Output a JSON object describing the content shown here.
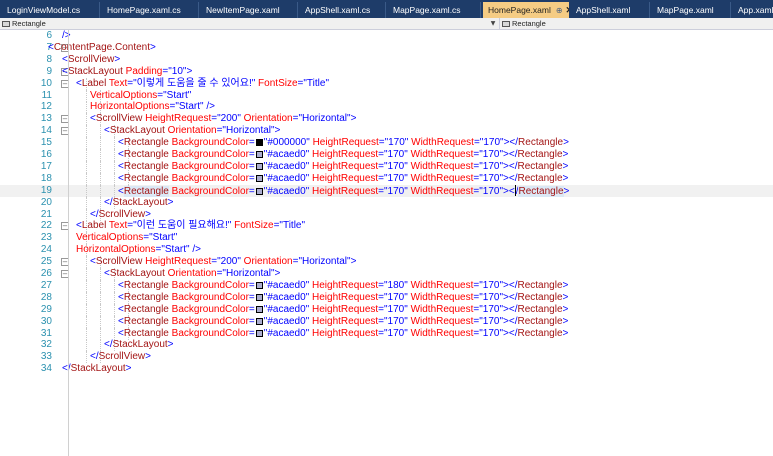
{
  "colors": {
    "tag": "#a31515",
    "attr": "#ff0000",
    "value": "#0000ff",
    "punct": "#0000ff",
    "linenum": "#2b91af",
    "swatch_black": "#000000",
    "swatch_gray": "#acaed0"
  },
  "tabs": [
    {
      "label": "LoginViewModel.cs",
      "active": false
    },
    {
      "label": "HomePage.xaml.cs",
      "active": false
    },
    {
      "label": "NewItemPage.xaml",
      "active": false
    },
    {
      "label": "AppShell.xaml.cs",
      "active": false
    },
    {
      "label": "MapPage.xaml.cs",
      "active": false
    },
    {
      "label": "HomePage.xaml",
      "active": true,
      "pin": "⊕",
      "close": "✕"
    },
    {
      "label": "AppShell.xaml",
      "active": false
    },
    {
      "label": "MapPage.xaml",
      "active": false
    },
    {
      "label": "App.xaml",
      "active": false
    }
  ],
  "navbar": {
    "left_combo": "Rectangle",
    "right_combo": "Rectangle",
    "dropdown_arrow": "▼"
  },
  "editor": {
    "lines": [
      {
        "n": "6",
        "indent": 4,
        "fold": "",
        "hl": false,
        "tokens": [
          {
            "t": "/>",
            "c": "value"
          }
        ]
      },
      {
        "n": "7",
        "indent": 3,
        "fold": "⊟",
        "hl": false,
        "tokens": [
          {
            "t": "<",
            "c": "value"
          },
          {
            "t": "ContentPage.Content",
            "c": "tag"
          },
          {
            "t": ">",
            "c": "value"
          }
        ]
      },
      {
        "n": "8",
        "indent": 4,
        "fold": "",
        "hl": false,
        "tokens": [
          {
            "t": "<",
            "c": "value"
          },
          {
            "t": "ScrollView",
            "c": "tag"
          },
          {
            "t": ">",
            "c": "value"
          }
        ]
      },
      {
        "n": "9",
        "indent": 4,
        "fold": "⊟",
        "hl": false,
        "tokens": [
          {
            "t": "<",
            "c": "value"
          },
          {
            "t": "StackLayout",
            "c": "tag"
          },
          {
            "t": " Padding",
            "c": "attr"
          },
          {
            "t": "=\"10\">",
            "c": "value"
          }
        ]
      },
      {
        "n": "10",
        "indent": 5,
        "fold": "⊟",
        "hl": false,
        "tokens": [
          {
            "t": "<",
            "c": "value"
          },
          {
            "t": "Label",
            "c": "tag"
          },
          {
            "t": " Text",
            "c": "attr"
          },
          {
            "t": "=\"이렇게 도움을 줄 수 있어요!\"",
            "c": "value"
          },
          {
            "t": " FontSize",
            "c": "attr"
          },
          {
            "t": "=\"Title\"",
            "c": "value"
          }
        ]
      },
      {
        "n": "11",
        "indent": 6,
        "fold": "",
        "hl": false,
        "tokens": [
          {
            "t": "VerticalOptions",
            "c": "attr"
          },
          {
            "t": "=\"Start\"",
            "c": "value"
          }
        ]
      },
      {
        "n": "12",
        "indent": 6,
        "fold": "",
        "hl": false,
        "tokens": [
          {
            "t": "HorizontalOptions",
            "c": "attr"
          },
          {
            "t": "=\"Start\" />",
            "c": "value"
          }
        ]
      },
      {
        "n": "13",
        "indent": 6,
        "fold": "⊟",
        "hl": false,
        "tokens": [
          {
            "t": "<",
            "c": "value"
          },
          {
            "t": "ScrollView",
            "c": "tag"
          },
          {
            "t": " HeightRequest",
            "c": "attr"
          },
          {
            "t": "=\"200\"",
            "c": "value"
          },
          {
            "t": " Orientation",
            "c": "attr"
          },
          {
            "t": "=\"Horizontal\">",
            "c": "value"
          }
        ]
      },
      {
        "n": "14",
        "indent": 7,
        "fold": "⊟",
        "hl": false,
        "tokens": [
          {
            "t": "<",
            "c": "value"
          },
          {
            "t": "StackLayout",
            "c": "tag"
          },
          {
            "t": " Orientation",
            "c": "attr"
          },
          {
            "t": "=\"Horizontal\">",
            "c": "value"
          }
        ]
      },
      {
        "n": "15",
        "indent": 8,
        "fold": "",
        "hl": false,
        "tokens": [
          {
            "t": "<",
            "c": "value"
          },
          {
            "t": "Rectangle",
            "c": "tag"
          },
          {
            "t": " BackgroundColor",
            "c": "attr"
          },
          {
            "t": "=",
            "c": "value"
          },
          {
            "swatch": "#000000"
          },
          {
            "t": "\"#000000\"",
            "c": "value"
          },
          {
            "t": " HeightRequest",
            "c": "attr"
          },
          {
            "t": "=\"170\"",
            "c": "value"
          },
          {
            "t": " WidthRequest",
            "c": "attr"
          },
          {
            "t": "=\"170\"></",
            "c": "value"
          },
          {
            "t": "Rectangle",
            "c": "tag"
          },
          {
            "t": ">",
            "c": "value"
          }
        ]
      },
      {
        "n": "16",
        "indent": 8,
        "fold": "",
        "hl": false,
        "tokens": [
          {
            "t": "<",
            "c": "value"
          },
          {
            "t": "Rectangle",
            "c": "tag"
          },
          {
            "t": " BackgroundColor",
            "c": "attr"
          },
          {
            "t": "=",
            "c": "value"
          },
          {
            "swatch": "#acaed0"
          },
          {
            "t": "\"#acaed0\"",
            "c": "value"
          },
          {
            "t": " HeightRequest",
            "c": "attr"
          },
          {
            "t": "=\"170\"",
            "c": "value"
          },
          {
            "t": " WidthRequest",
            "c": "attr"
          },
          {
            "t": "=\"170\"></",
            "c": "value"
          },
          {
            "t": "Rectangle",
            "c": "tag"
          },
          {
            "t": ">",
            "c": "value"
          }
        ]
      },
      {
        "n": "17",
        "indent": 8,
        "fold": "",
        "hl": false,
        "tokens": [
          {
            "t": "<",
            "c": "value"
          },
          {
            "t": "Rectangle",
            "c": "tag"
          },
          {
            "t": " BackgroundColor",
            "c": "attr"
          },
          {
            "t": "=",
            "c": "value"
          },
          {
            "swatch": "#acaed0"
          },
          {
            "t": "\"#acaed0\"",
            "c": "value"
          },
          {
            "t": " HeightRequest",
            "c": "attr"
          },
          {
            "t": "=\"170\"",
            "c": "value"
          },
          {
            "t": " WidthRequest",
            "c": "attr"
          },
          {
            "t": "=\"170\"></",
            "c": "value"
          },
          {
            "t": "Rectangle",
            "c": "tag"
          },
          {
            "t": ">",
            "c": "value"
          }
        ]
      },
      {
        "n": "18",
        "indent": 8,
        "fold": "",
        "hl": false,
        "tokens": [
          {
            "t": "<",
            "c": "value"
          },
          {
            "t": "Rectangle",
            "c": "tag"
          },
          {
            "t": " BackgroundColor",
            "c": "attr"
          },
          {
            "t": "=",
            "c": "value"
          },
          {
            "swatch": "#acaed0"
          },
          {
            "t": "\"#acaed0\"",
            "c": "value"
          },
          {
            "t": " HeightRequest",
            "c": "attr"
          },
          {
            "t": "=\"170\"",
            "c": "value"
          },
          {
            "t": " WidthRequest",
            "c": "attr"
          },
          {
            "t": "=\"170\"></",
            "c": "value"
          },
          {
            "t": "Rectangle",
            "c": "tag"
          },
          {
            "t": ">",
            "c": "value"
          }
        ]
      },
      {
        "n": "19",
        "indent": 8,
        "fold": "",
        "hl": true,
        "tokens": [
          {
            "t": "<",
            "c": "value"
          },
          {
            "t": "Rectangle",
            "c": "tag",
            "wordhl": true
          },
          {
            "t": " BackgroundColor",
            "c": "attr"
          },
          {
            "t": "=",
            "c": "value"
          },
          {
            "swatch": "#acaed0"
          },
          {
            "t": "\"#acaed0\"",
            "c": "value"
          },
          {
            "t": " HeightRequest",
            "c": "attr"
          },
          {
            "t": "=\"170\"",
            "c": "value"
          },
          {
            "t": " WidthRequest",
            "c": "attr"
          },
          {
            "t": "=\"170\"><",
            "c": "value"
          },
          {
            "caret": true
          },
          {
            "t": "/",
            "c": "value"
          },
          {
            "t": "Rectangle",
            "c": "tag",
            "wordhl": true
          },
          {
            "t": ">",
            "c": "value"
          }
        ]
      },
      {
        "n": "20",
        "indent": 7,
        "fold": "",
        "hl": false,
        "tokens": [
          {
            "t": "</",
            "c": "value"
          },
          {
            "t": "StackLayout",
            "c": "tag"
          },
          {
            "t": ">",
            "c": "value"
          }
        ]
      },
      {
        "n": "21",
        "indent": 6,
        "fold": "",
        "hl": false,
        "tokens": [
          {
            "t": "</",
            "c": "value"
          },
          {
            "t": "ScrollView",
            "c": "tag"
          },
          {
            "t": ">",
            "c": "value"
          }
        ]
      },
      {
        "n": "22",
        "indent": 5,
        "fold": "⊟",
        "hl": false,
        "tokens": [
          {
            "t": "<",
            "c": "value"
          },
          {
            "t": "Label",
            "c": "tag"
          },
          {
            "t": " Text",
            "c": "attr"
          },
          {
            "t": "=\"이런 도움이 필요해요!\"",
            "c": "value"
          },
          {
            "t": " FontSize",
            "c": "attr"
          },
          {
            "t": "=\"Title\"",
            "c": "value"
          }
        ]
      },
      {
        "n": "23",
        "indent": 5,
        "fold": "",
        "hl": false,
        "tokens": [
          {
            "t": "VerticalOptions",
            "c": "attr"
          },
          {
            "t": "=\"Start\"",
            "c": "value"
          }
        ]
      },
      {
        "n": "24",
        "indent": 5,
        "fold": "",
        "hl": false,
        "tokens": [
          {
            "t": "HorizontalOptions",
            "c": "attr"
          },
          {
            "t": "=\"Start\" />",
            "c": "value"
          }
        ]
      },
      {
        "n": "25",
        "indent": 6,
        "fold": "⊟",
        "hl": false,
        "tokens": [
          {
            "t": "<",
            "c": "value"
          },
          {
            "t": "ScrollView",
            "c": "tag"
          },
          {
            "t": " HeightRequest",
            "c": "attr"
          },
          {
            "t": "=\"200\"",
            "c": "value"
          },
          {
            "t": " Orientation",
            "c": "attr"
          },
          {
            "t": "=\"Horizontal\">",
            "c": "value"
          }
        ]
      },
      {
        "n": "26",
        "indent": 7,
        "fold": "⊟",
        "hl": false,
        "tokens": [
          {
            "t": "<",
            "c": "value"
          },
          {
            "t": "StackLayout",
            "c": "tag"
          },
          {
            "t": " Orientation",
            "c": "attr"
          },
          {
            "t": "=\"Horizontal\">",
            "c": "value"
          }
        ]
      },
      {
        "n": "27",
        "indent": 8,
        "fold": "",
        "hl": false,
        "tokens": [
          {
            "t": "<",
            "c": "value"
          },
          {
            "t": "Rectangle",
            "c": "tag"
          },
          {
            "t": " BackgroundColor",
            "c": "attr"
          },
          {
            "t": "=",
            "c": "value"
          },
          {
            "swatch": "#acaed0"
          },
          {
            "t": "\"#acaed0\"",
            "c": "value"
          },
          {
            "t": " HeightRequest",
            "c": "attr"
          },
          {
            "t": "=\"180\"",
            "c": "value"
          },
          {
            "t": " WidthRequest",
            "c": "attr"
          },
          {
            "t": "=\"170\"></",
            "c": "value"
          },
          {
            "t": "Rectangle",
            "c": "tag"
          },
          {
            "t": ">",
            "c": "value"
          }
        ]
      },
      {
        "n": "28",
        "indent": 8,
        "fold": "",
        "hl": false,
        "tokens": [
          {
            "t": "<",
            "c": "value"
          },
          {
            "t": "Rectangle",
            "c": "tag"
          },
          {
            "t": " BackgroundColor",
            "c": "attr"
          },
          {
            "t": "=",
            "c": "value"
          },
          {
            "swatch": "#acaed0"
          },
          {
            "t": "\"#acaed0\"",
            "c": "value"
          },
          {
            "t": " HeightRequest",
            "c": "attr"
          },
          {
            "t": "=\"170\"",
            "c": "value"
          },
          {
            "t": " WidthRequest",
            "c": "attr"
          },
          {
            "t": "=\"170\"></",
            "c": "value"
          },
          {
            "t": "Rectangle",
            "c": "tag"
          },
          {
            "t": ">",
            "c": "value"
          }
        ]
      },
      {
        "n": "29",
        "indent": 8,
        "fold": "",
        "hl": false,
        "tokens": [
          {
            "t": "<",
            "c": "value"
          },
          {
            "t": "Rectangle",
            "c": "tag"
          },
          {
            "t": " BackgroundColor",
            "c": "attr"
          },
          {
            "t": "=",
            "c": "value"
          },
          {
            "swatch": "#acaed0"
          },
          {
            "t": "\"#acaed0\"",
            "c": "value"
          },
          {
            "t": " HeightRequest",
            "c": "attr"
          },
          {
            "t": "=\"170\"",
            "c": "value"
          },
          {
            "t": " WidthRequest",
            "c": "attr"
          },
          {
            "t": "=\"170\"></",
            "c": "value"
          },
          {
            "t": "Rectangle",
            "c": "tag"
          },
          {
            "t": ">",
            "c": "value"
          }
        ]
      },
      {
        "n": "30",
        "indent": 8,
        "fold": "",
        "hl": false,
        "tokens": [
          {
            "t": "<",
            "c": "value"
          },
          {
            "t": "Rectangle",
            "c": "tag"
          },
          {
            "t": " BackgroundColor",
            "c": "attr"
          },
          {
            "t": "=",
            "c": "value"
          },
          {
            "swatch": "#acaed0"
          },
          {
            "t": "\"#acaed0\"",
            "c": "value"
          },
          {
            "t": " HeightRequest",
            "c": "attr"
          },
          {
            "t": "=\"170\"",
            "c": "value"
          },
          {
            "t": " WidthRequest",
            "c": "attr"
          },
          {
            "t": "=\"170\"></",
            "c": "value"
          },
          {
            "t": "Rectangle",
            "c": "tag"
          },
          {
            "t": ">",
            "c": "value"
          }
        ]
      },
      {
        "n": "31",
        "indent": 8,
        "fold": "",
        "hl": false,
        "tokens": [
          {
            "t": "<",
            "c": "value"
          },
          {
            "t": "Rectangle",
            "c": "tag"
          },
          {
            "t": " BackgroundColor",
            "c": "attr"
          },
          {
            "t": "=",
            "c": "value"
          },
          {
            "swatch": "#acaed0"
          },
          {
            "t": "\"#acaed0\"",
            "c": "value"
          },
          {
            "t": " HeightRequest",
            "c": "attr"
          },
          {
            "t": "=\"170\"",
            "c": "value"
          },
          {
            "t": " WidthRequest",
            "c": "attr"
          },
          {
            "t": "=\"170\"></",
            "c": "value"
          },
          {
            "t": "Rectangle",
            "c": "tag"
          },
          {
            "t": ">",
            "c": "value"
          }
        ]
      },
      {
        "n": "32",
        "indent": 7,
        "fold": "",
        "hl": false,
        "tokens": [
          {
            "t": "</",
            "c": "value"
          },
          {
            "t": "StackLayout",
            "c": "tag"
          },
          {
            "t": ">",
            "c": "value"
          }
        ]
      },
      {
        "n": "33",
        "indent": 6,
        "fold": "",
        "hl": false,
        "tokens": [
          {
            "t": "</",
            "c": "value"
          },
          {
            "t": "ScrollView",
            "c": "tag"
          },
          {
            "t": ">",
            "c": "value"
          }
        ]
      },
      {
        "n": "34",
        "indent": 4,
        "fold": "",
        "hl": false,
        "tokens": [
          {
            "t": "</",
            "c": "value"
          },
          {
            "t": "StackLayout",
            "c": "tag"
          },
          {
            "t": ">",
            "c": "value"
          }
        ]
      }
    ]
  }
}
